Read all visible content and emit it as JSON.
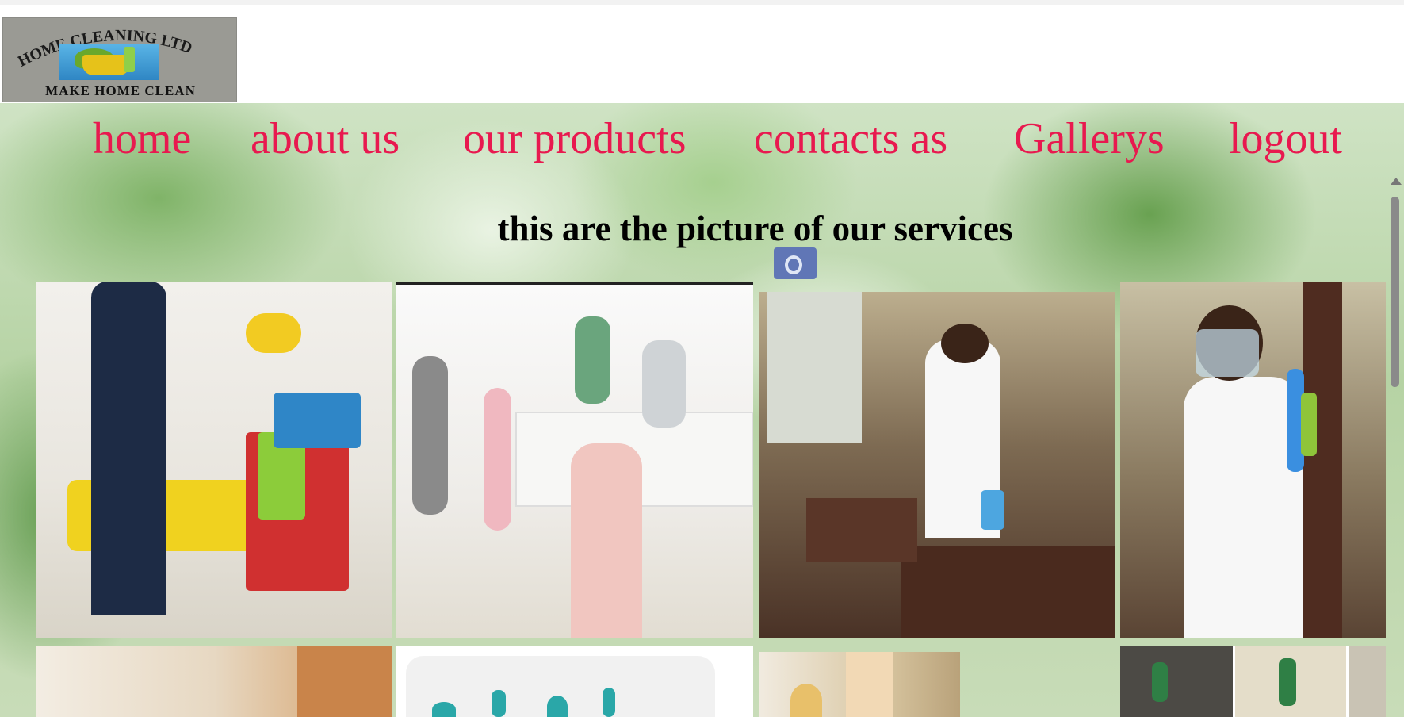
{
  "logo": {
    "arc_text": "HOME CLEANING LTD",
    "tagline": "MAKE HOME CLEAN"
  },
  "nav": {
    "items": [
      {
        "label": "home"
      },
      {
        "label": "about us"
      },
      {
        "label": "our products"
      },
      {
        "label": "contacts as"
      },
      {
        "label": "Gallerys"
      },
      {
        "label": "logout"
      }
    ]
  },
  "main": {
    "heading": "this are the picture of our services"
  },
  "colors": {
    "nav_link": "#e8194f",
    "heading": "#000000"
  },
  "icons": [
    "camera-shutter-icon",
    "scroll-up-arrow-icon"
  ]
}
